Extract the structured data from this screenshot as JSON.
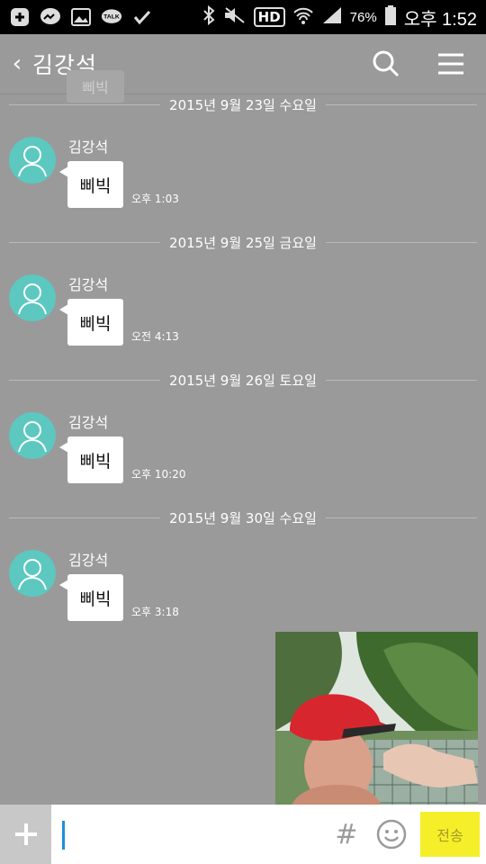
{
  "status_bar": {
    "battery": "76%",
    "time": "오후 1:52",
    "hd_label": "HD",
    "talk_label": "TALK"
  },
  "header": {
    "back_symbol": "‹",
    "title": "김강석",
    "ghost_preview": "삐빅"
  },
  "dates": [
    "2015년 9월 23일 수요일",
    "2015년 9월 25일 금요일",
    "2015년 9월 26일 토요일",
    "2015년 9월 30일 수요일"
  ],
  "messages": [
    {
      "sender": "김강석",
      "text": "삐빅",
      "time": "오후 1:03"
    },
    {
      "sender": "김강석",
      "text": "삐빅",
      "time": "오전 4:13"
    },
    {
      "sender": "김강석",
      "text": "삐빅",
      "time": "오후 10:20"
    },
    {
      "sender": "김강석",
      "text": "삐빅",
      "time": "오후 3:18"
    }
  ],
  "input_bar": {
    "plus": "+",
    "hash": "#",
    "send_label": "전송"
  },
  "colors": {
    "background": "#9a9a9a",
    "avatar": "#5cc8c0",
    "send": "#f5ef2a"
  }
}
